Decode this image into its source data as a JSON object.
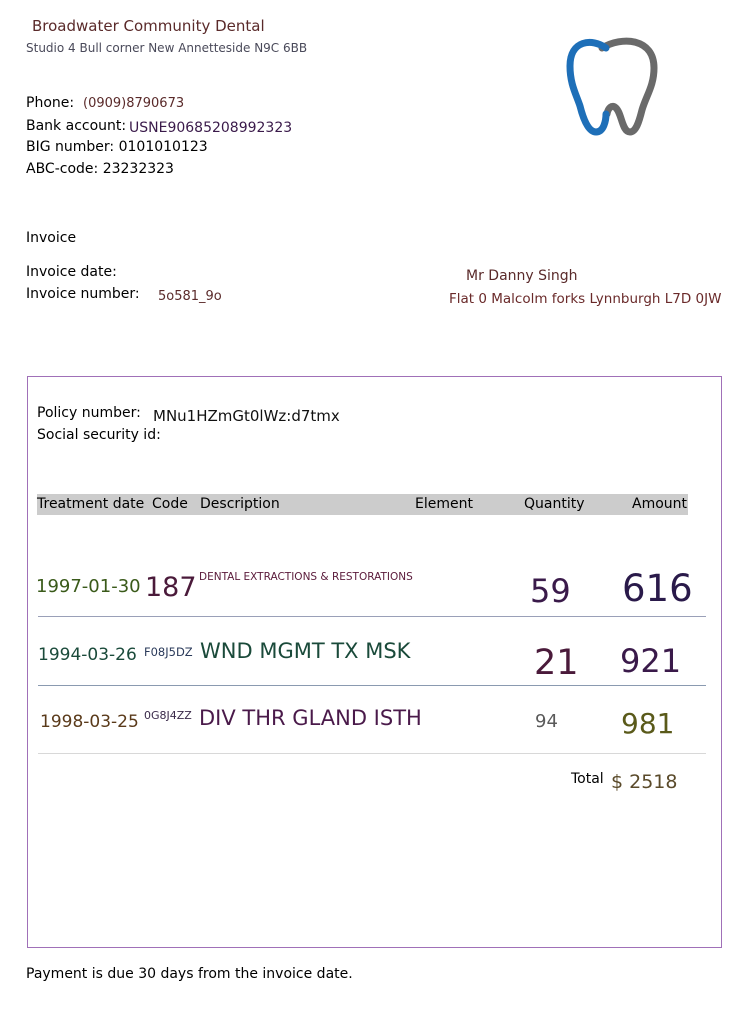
{
  "practice": {
    "name": "Broadwater Community Dental",
    "address": "Studio 4 Bull corner New Annetteside N9C 6BB",
    "phone_label": "Phone:",
    "phone": "(0909)8790673",
    "bank_label": "Bank account:",
    "bank_account": "USNE90685208992323",
    "big_line": "BIG number: 0101010123",
    "abc_line": "ABC-code: 23232323"
  },
  "invoice": {
    "title": "Invoice",
    "date_label": "Invoice date:",
    "number_label": "Invoice number:",
    "number": "5o581_9o"
  },
  "recipient": {
    "name": "Mr Danny Singh",
    "address": "Flat 0 Malcolm forks Lynnburgh L7D 0JW"
  },
  "policy": {
    "number_label": "Policy number:",
    "number": "MNu1HZmGt0lWz:d7tmx",
    "ssid_label": "Social security id:"
  },
  "table": {
    "headers": {
      "date": "Treatment date",
      "code": "Code",
      "description": "Description",
      "element": "Element",
      "quantity": "Quantity",
      "amount": "Amount"
    },
    "rows": [
      {
        "date": "1997-01-30",
        "code": "187",
        "description": "DENTAL EXTRACTIONS & RESTORATIONS",
        "element": "",
        "quantity": "59",
        "amount": "616"
      },
      {
        "date": "1994-03-26",
        "code": "F08J5DZ",
        "description": "WND MGMT TX MSK",
        "element": "",
        "quantity": "21",
        "amount": "921"
      },
      {
        "date": "1998-03-25",
        "code": "0G8J4ZZ",
        "description": "DIV THR GLAND ISTH",
        "element": "",
        "quantity": "94",
        "amount": "981"
      }
    ]
  },
  "total": {
    "label": "Total",
    "value": "$ 2518"
  },
  "footer": {
    "payment_note": "Payment is due 30 days from the invoice date."
  },
  "logo": {
    "icon": "tooth-icon",
    "colors": {
      "front": "#1e6fb8",
      "back": "#6a6a6a"
    }
  }
}
